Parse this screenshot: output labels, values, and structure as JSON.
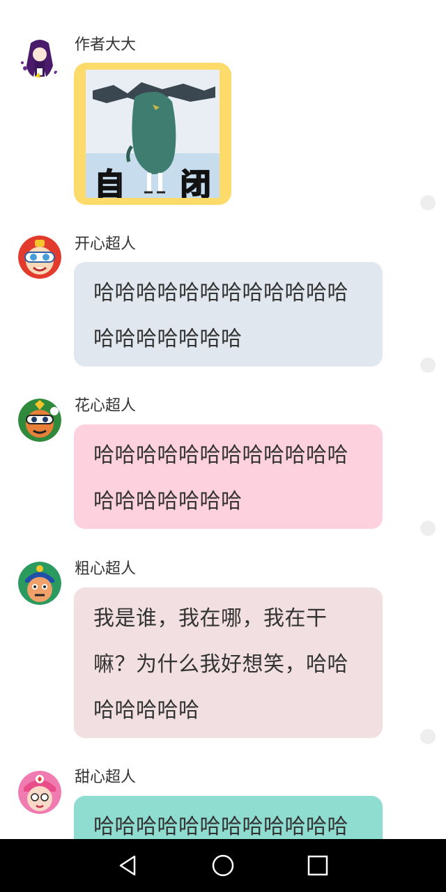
{
  "messages": [
    {
      "sender": "作者大大",
      "type": "sticker",
      "sticker_caption": [
        "自",
        "闭"
      ],
      "sticker_icon": "sad-cartoon-sticker-icon",
      "avatar_icon": "purple-hair-girl-avatar-icon"
    },
    {
      "sender": "开心超人",
      "type": "text",
      "text": "哈哈哈哈哈哈哈哈哈哈哈哈哈哈哈哈哈哈哈",
      "bubble_color": "#e1e7ef",
      "avatar_icon": "happy-superman-avatar-icon"
    },
    {
      "sender": "花心超人",
      "type": "text",
      "text": "哈哈哈哈哈哈哈哈哈哈哈哈哈哈哈哈哈哈哈",
      "bubble_color": "#fdd1dd",
      "avatar_icon": "flower-superman-avatar-icon"
    },
    {
      "sender": "粗心超人",
      "type": "text",
      "text": "我是谁，我在哪，我在干嘛？为什么我好想笑，哈哈哈哈哈哈哈",
      "bubble_color": "#f2dfe2",
      "avatar_icon": "careless-superman-avatar-icon"
    },
    {
      "sender": "甜心超人",
      "type": "text",
      "text": "哈哈哈哈哈哈哈哈哈哈哈哈哈哈哈哈哈哈哈",
      "bubble_color": "#8fdcd0",
      "avatar_icon": "sweet-superman-avatar-icon"
    }
  ],
  "nav_bar": {
    "buttons": [
      "back-icon",
      "home-icon",
      "recents-icon"
    ]
  }
}
